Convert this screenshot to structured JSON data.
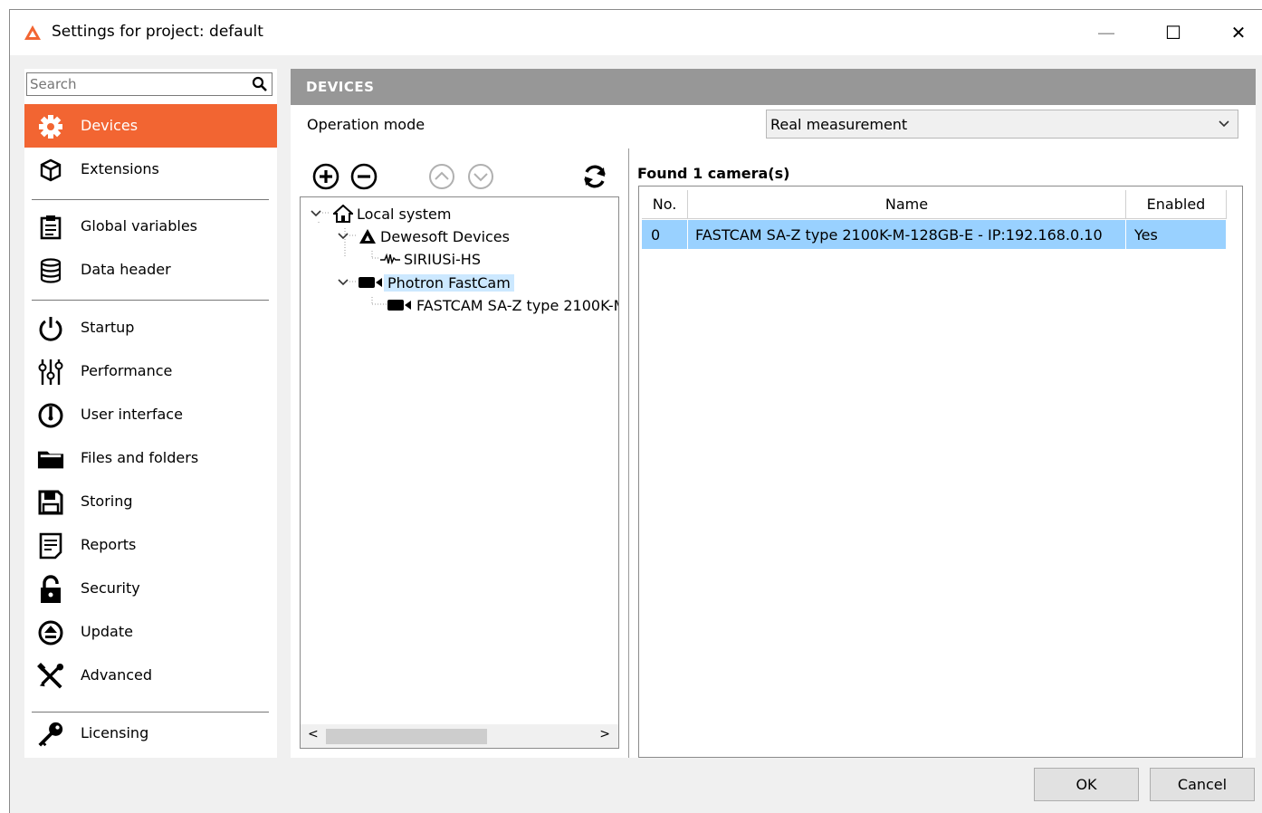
{
  "window": {
    "title": "Settings for project: default",
    "minimize": "—",
    "maximize": "☐",
    "close": "✕"
  },
  "search": {
    "placeholder": "Search",
    "value": ""
  },
  "sidebar": {
    "items": [
      {
        "label": "Devices",
        "icon": "gear-icon",
        "active": true
      },
      {
        "label": "Extensions",
        "icon": "cube-icon"
      },
      {
        "label": "Global variables",
        "icon": "clipboard-icon"
      },
      {
        "label": "Data header",
        "icon": "database-icon"
      },
      {
        "label": "Startup",
        "icon": "power-icon"
      },
      {
        "label": "Performance",
        "icon": "sliders-icon"
      },
      {
        "label": "User interface",
        "icon": "gauge-icon"
      },
      {
        "label": "Files and folders",
        "icon": "folder-icon"
      },
      {
        "label": "Storing",
        "icon": "floppy-icon"
      },
      {
        "label": "Reports",
        "icon": "report-icon"
      },
      {
        "label": "Security",
        "icon": "lock-icon"
      },
      {
        "label": "Update",
        "icon": "upload-icon"
      },
      {
        "label": "Advanced",
        "icon": "tools-icon"
      },
      {
        "label": "Licensing",
        "icon": "key-icon"
      }
    ]
  },
  "main": {
    "header": "DEVICES",
    "operation_mode": {
      "label": "Operation mode",
      "selected": "Real measurement"
    },
    "tree": {
      "nodes": [
        {
          "label": "Local system",
          "icon": "home-icon"
        },
        {
          "label": "Dewesoft Devices",
          "icon": "dewesoft-logo-icon"
        },
        {
          "label": "SIRIUSi-HS",
          "icon": "signal-icon"
        },
        {
          "label": "Photron FastCam",
          "icon": "camera-icon",
          "selected": true
        },
        {
          "label": "FASTCAM SA-Z type 2100K-M-128GB-E - IP:192.168.0.10",
          "icon": "camera-icon"
        }
      ]
    },
    "found_text": "Found 1 camera(s)",
    "table": {
      "columns": [
        "No.",
        "Name",
        "Enabled"
      ],
      "rows": [
        [
          "0",
          "FASTCAM SA-Z type 2100K-M-128GB-E - IP:192.168.0.10",
          "Yes"
        ]
      ]
    }
  },
  "footer": {
    "ok": "OK",
    "cancel": "Cancel"
  },
  "colors": {
    "accent": "#f26532",
    "header": "#979797",
    "selection": "#99d1ff",
    "tree_selection": "#cce8ff"
  }
}
